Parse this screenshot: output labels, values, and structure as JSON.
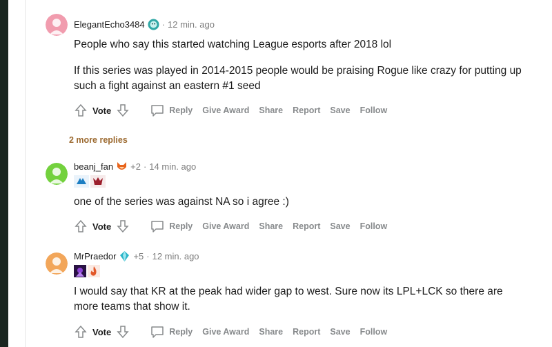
{
  "comments": [
    {
      "username": "ElegantEcho3484",
      "flair_icon": "teal-face-icon",
      "time": "12 min. ago",
      "separator": "·",
      "paragraphs": [
        "People who say this started watching League esports after 2018 lol",
        "If this series was played in 2014-2015 people would be praising Rogue like crazy for putting up such a fight against an eastern #1 seed"
      ]
    },
    {
      "username": "beanj_fan",
      "flair_icon": "fox-icon",
      "karma": "+2",
      "time": "14 min. ago",
      "separator": "·",
      "badges": [
        "cloud9-logo",
        "team-mascot-logo"
      ],
      "paragraphs": [
        "one of the series was against NA so i agree :)"
      ]
    },
    {
      "username": "MrPraedor",
      "flair_icon": "crystal-icon",
      "karma": "+5",
      "time": "12 min. ago",
      "separator": "·",
      "badges": [
        "purple-champion-icon",
        "flame-icon"
      ],
      "paragraphs": [
        "I would say that KR at the peak had wider gap to west. Sure now its LPL+LCK so there are more teams that show it."
      ]
    }
  ],
  "actions": {
    "vote": "Vote",
    "reply": "Reply",
    "give_award": "Give Award",
    "share": "Share",
    "report": "Report",
    "save": "Save",
    "follow": "Follow"
  },
  "more_replies": "2 more replies",
  "colors": {
    "accent_more_replies": "#9c6a30",
    "action_gray": "#878a8c",
    "left_strip": "#1a2620"
  }
}
